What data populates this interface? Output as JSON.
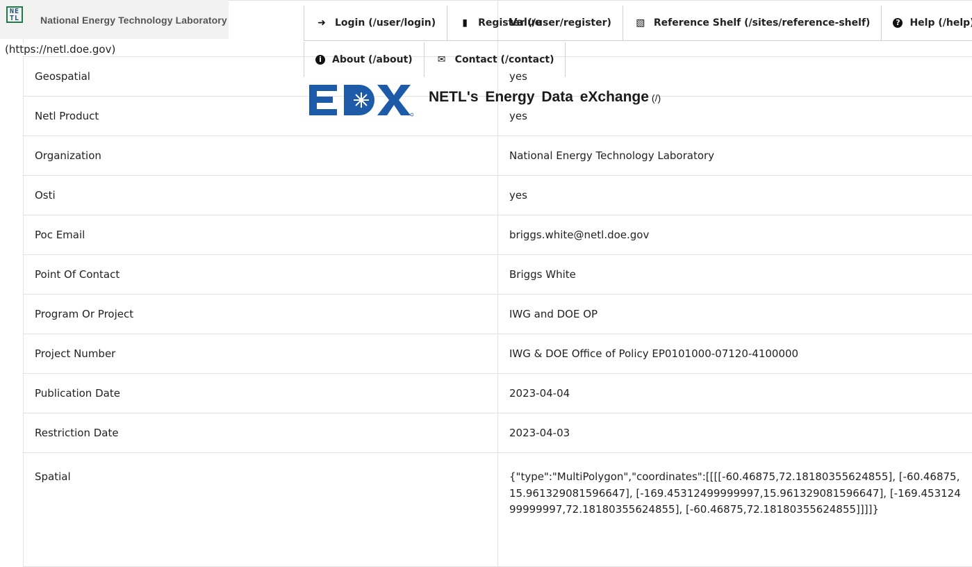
{
  "header": {
    "netl_name": "National Energy Technology Laboratory",
    "netl_url": "(https://netl.doe.gov)",
    "edx_title": "NETL's  Energy  Data eXchange",
    "edx_path": "(/)"
  },
  "nav": {
    "items": [
      {
        "icon": "sign-in-icon",
        "label": "Login (/user/login)"
      },
      {
        "icon": "clipboard-icon",
        "label": "Register (/user/register)"
      },
      {
        "icon": "book-icon",
        "label": "Reference Shelf (/sites/reference-shelf)"
      },
      {
        "icon": "question-circle-icon",
        "label": "Help (/help)"
      },
      {
        "icon": "info-circle-icon",
        "label": "About (/about)"
      },
      {
        "icon": "envelope-icon",
        "label": "Contact (/contact)"
      }
    ]
  },
  "table": {
    "header_value": "Value",
    "rows": [
      {
        "key": "Geospatial",
        "value": "yes"
      },
      {
        "key": "Netl Product",
        "value": "yes"
      },
      {
        "key": "Organization",
        "value": "National Energy Technology Laboratory"
      },
      {
        "key": "Osti",
        "value": "yes"
      },
      {
        "key": "Poc Email",
        "value": "briggs.white@netl.doe.gov"
      },
      {
        "key": "Point Of Contact",
        "value": "Briggs White"
      },
      {
        "key": "Program Or Project",
        "value": "IWG and DOE OP"
      },
      {
        "key": "Project Number",
        "value": "IWG & DOE Office of Policy EP0101000-07120-4100000"
      },
      {
        "key": "Publication Date",
        "value": "2023-04-04"
      },
      {
        "key": "Restriction Date",
        "value": "2023-04-03"
      },
      {
        "key": "Spatial",
        "value": "{\"type\":\"MultiPolygon\",\"coordinates\":[[[[-60.46875,72.18180355624855], [-60.46875,15.961329081596647], [-169.45312499999997,15.961329081596647], [-169.45312499999997,72.18180355624855], [-60.46875,72.18180355624855]]]]}"
      }
    ]
  },
  "colors": {
    "edx_blue": "#1d5aa8",
    "netl_green": "#1f7a4a"
  }
}
